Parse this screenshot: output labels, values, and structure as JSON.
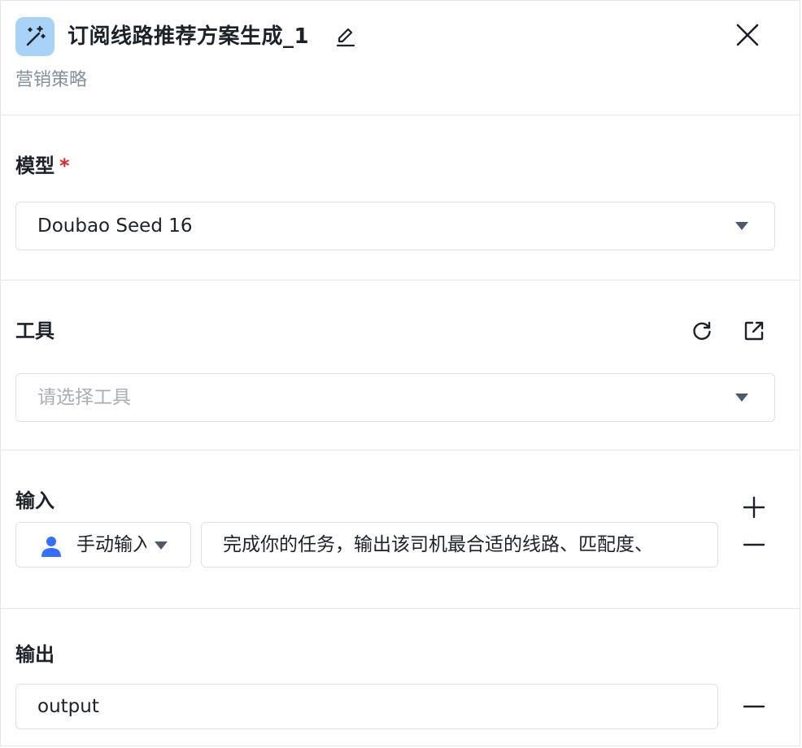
{
  "header": {
    "title": "订阅线路推荐方案生成_1",
    "subtitle": "营销策略",
    "icons": {
      "node": "magic-wand-icon",
      "edit": "pencil-icon",
      "close": "close-icon"
    }
  },
  "model": {
    "label": "模型",
    "required_mark": "*",
    "selected": "Doubao Seed 16"
  },
  "tools": {
    "label": "工具",
    "placeholder": "请选择工具",
    "icons": {
      "refresh": "refresh-icon",
      "open": "external-link-icon"
    }
  },
  "input": {
    "label": "输入",
    "source": "手动输入",
    "value": "完成你的任务，输出该司机最合适的线路、匹配度、"
  },
  "output": {
    "label": "输出",
    "value": "output"
  },
  "colors": {
    "accent": "#3370ff",
    "icon_bg": "#a8d2f7",
    "required": "#e5252a",
    "border": "#dfe1e5",
    "muted": "#86909c"
  }
}
